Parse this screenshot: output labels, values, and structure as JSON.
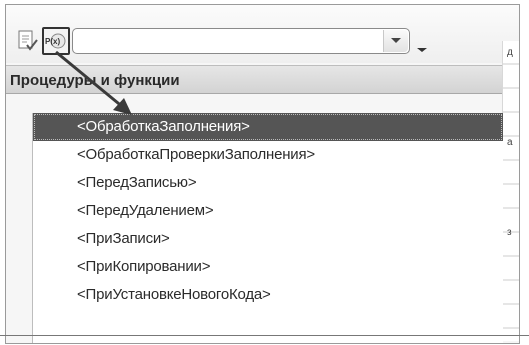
{
  "toolbar": {
    "check_button_icon": "check-list-icon",
    "proc_button_icon": "procedure-icon",
    "proc_button_badge": "P(x)",
    "combo": {
      "value": "",
      "dropdown_icon": "chevron-down-icon",
      "menu_icon": "menu-down-icon"
    }
  },
  "panel": {
    "header": "Процедуры и функции",
    "items": [
      {
        "label": "<ОбработкаЗаполнения>",
        "selected": true
      },
      {
        "label": "<ОбработкаПроверкиЗаполнения>",
        "selected": false
      },
      {
        "label": "<ПередЗаписью>",
        "selected": false
      },
      {
        "label": "<ПередУдалением>",
        "selected": false
      },
      {
        "label": "<ПриЗаписи>",
        "selected": false
      },
      {
        "label": "<ПриКопировании>",
        "selected": false
      },
      {
        "label": "<ПриУстановкеНовогоКода>",
        "selected": false
      }
    ]
  },
  "colors": {
    "selected_bg": "#555555",
    "header_bg": "#dcdcdc",
    "window_bg": "#f6f6f6"
  }
}
